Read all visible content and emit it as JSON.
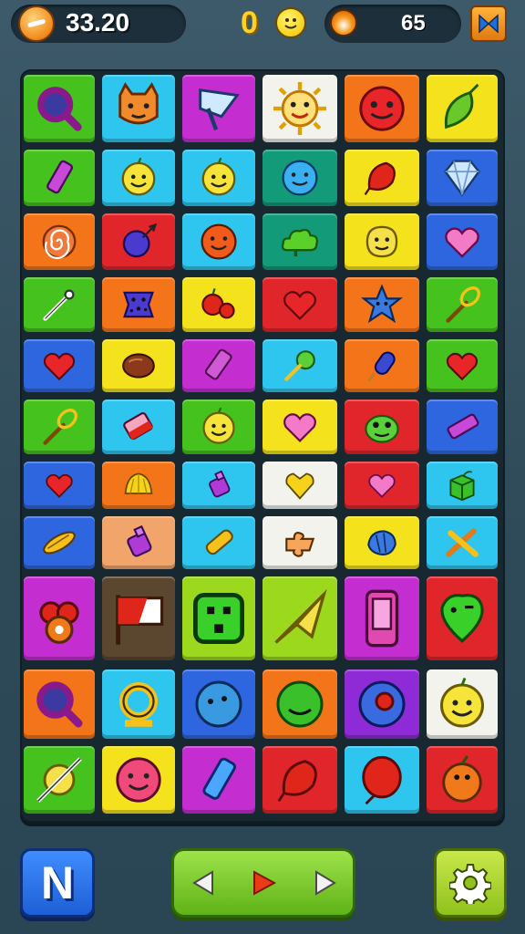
{
  "hud": {
    "score": "33.20",
    "moves": "0",
    "energy": "65"
  },
  "colors": {
    "green": "#46c21e",
    "lime": "#9bd81e",
    "cyan": "#2ec6ef",
    "magenta": "#c42ed0",
    "purple": "#8e2ad6",
    "white": "#f3f3ee",
    "orange": "#f4741a",
    "yellow": "#f4e21c",
    "red": "#e0262a",
    "blue": "#2e66e0",
    "teal": "#139a78",
    "peach": "#f2a56a",
    "brown": "#5b4630"
  },
  "board": {
    "tiles": [
      {
        "row": 0,
        "col": 0,
        "color": "green",
        "icon": "magnifier-icon"
      },
      {
        "row": 0,
        "col": 1,
        "color": "cyan",
        "icon": "cat-face-icon"
      },
      {
        "row": 0,
        "col": 2,
        "color": "magenta",
        "icon": "flag-icon"
      },
      {
        "row": 0,
        "col": 3,
        "color": "white",
        "icon": "sun-face-icon"
      },
      {
        "row": 0,
        "col": 4,
        "color": "orange",
        "icon": "red-smiley-icon"
      },
      {
        "row": 0,
        "col": 5,
        "color": "yellow",
        "icon": "leaf-icon"
      },
      {
        "row": 1,
        "col": 0,
        "color": "green",
        "icon": "crayon-icon"
      },
      {
        "row": 1,
        "col": 1,
        "color": "cyan",
        "icon": "yellow-smiley-icon"
      },
      {
        "row": 1,
        "col": 2,
        "color": "cyan",
        "icon": "yellow-smiley-icon"
      },
      {
        "row": 1,
        "col": 3,
        "color": "teal",
        "icon": "blue-smiley-icon"
      },
      {
        "row": 1,
        "col": 4,
        "color": "yellow",
        "icon": "red-leaf-icon"
      },
      {
        "row": 1,
        "col": 5,
        "color": "blue",
        "icon": "gem-icon"
      },
      {
        "row": 2,
        "col": 0,
        "color": "orange",
        "icon": "swirl-icon"
      },
      {
        "row": 2,
        "col": 1,
        "color": "red",
        "icon": "blue-fruit-icon"
      },
      {
        "row": 2,
        "col": 2,
        "color": "cyan",
        "icon": "orange-smiley-icon"
      },
      {
        "row": 2,
        "col": 3,
        "color": "teal",
        "icon": "cloud-icon"
      },
      {
        "row": 2,
        "col": 4,
        "color": "yellow",
        "icon": "potato-face-icon"
      },
      {
        "row": 2,
        "col": 5,
        "color": "blue",
        "icon": "pink-heart-icon"
      },
      {
        "row": 3,
        "col": 0,
        "color": "green",
        "icon": "wand-icon"
      },
      {
        "row": 3,
        "col": 1,
        "color": "orange",
        "icon": "blue-cookie-icon"
      },
      {
        "row": 3,
        "col": 2,
        "color": "yellow",
        "icon": "apples-icon"
      },
      {
        "row": 3,
        "col": 3,
        "color": "red",
        "icon": "red-heart-icon"
      },
      {
        "row": 3,
        "col": 4,
        "color": "orange",
        "icon": "star-face-icon"
      },
      {
        "row": 3,
        "col": 5,
        "color": "green",
        "icon": "whisk-icon"
      },
      {
        "row": 4,
        "col": 0,
        "color": "blue",
        "icon": "red-heart-icon"
      },
      {
        "row": 4,
        "col": 1,
        "color": "yellow",
        "icon": "bean-icon"
      },
      {
        "row": 4,
        "col": 2,
        "color": "magenta",
        "icon": "purple-eraser-icon"
      },
      {
        "row": 4,
        "col": 3,
        "color": "cyan",
        "icon": "lollipop-icon"
      },
      {
        "row": 4,
        "col": 4,
        "color": "orange",
        "icon": "blue-popsicle-icon"
      },
      {
        "row": 4,
        "col": 5,
        "color": "green",
        "icon": "red-heart-icon"
      },
      {
        "row": 5,
        "col": 0,
        "color": "green",
        "icon": "whisk-icon"
      },
      {
        "row": 5,
        "col": 1,
        "color": "cyan",
        "icon": "eraser-icon"
      },
      {
        "row": 5,
        "col": 2,
        "color": "green",
        "icon": "yellow-smiley-icon"
      },
      {
        "row": 5,
        "col": 3,
        "color": "yellow",
        "icon": "pink-heart-icon"
      },
      {
        "row": 5,
        "col": 4,
        "color": "red",
        "icon": "green-frog-icon"
      },
      {
        "row": 5,
        "col": 5,
        "color": "blue",
        "icon": "purple-crayon-icon"
      },
      {
        "row": 6,
        "col": 0,
        "color": "blue",
        "icon": "red-heart-icon"
      },
      {
        "row": 6,
        "col": 1,
        "color": "orange",
        "icon": "shell-icon"
      },
      {
        "row": 6,
        "col": 2,
        "color": "cyan",
        "icon": "purple-bottle-icon"
      },
      {
        "row": 6,
        "col": 3,
        "color": "white",
        "icon": "gold-heart-icon"
      },
      {
        "row": 6,
        "col": 4,
        "color": "red",
        "icon": "pink-heart-icon"
      },
      {
        "row": 6,
        "col": 5,
        "color": "cyan",
        "icon": "green-cube-icon"
      },
      {
        "row": 7,
        "col": 0,
        "color": "blue",
        "icon": "corn-icon"
      },
      {
        "row": 7,
        "col": 1,
        "color": "peach",
        "icon": "purple-bottle-icon"
      },
      {
        "row": 7,
        "col": 2,
        "color": "cyan",
        "icon": "yellow-crayon-icon"
      },
      {
        "row": 7,
        "col": 3,
        "color": "white",
        "icon": "puzzle-piece-icon"
      },
      {
        "row": 7,
        "col": 4,
        "color": "yellow",
        "icon": "blue-shell-icon"
      },
      {
        "row": 7,
        "col": 5,
        "color": "cyan",
        "icon": "cross-sticks-icon"
      },
      {
        "row": 8,
        "col": 0,
        "color": "magenta",
        "icon": "fruit-bunch-icon"
      },
      {
        "row": 8,
        "col": 1,
        "color": "brown",
        "icon": "red-flag-icon"
      },
      {
        "row": 8,
        "col": 2,
        "color": "lime",
        "icon": "block-face-icon"
      },
      {
        "row": 8,
        "col": 3,
        "color": "lime",
        "icon": "paper-plane-icon"
      },
      {
        "row": 8,
        "col": 4,
        "color": "magenta",
        "icon": "phone-icon"
      },
      {
        "row": 8,
        "col": 5,
        "color": "red",
        "icon": "green-balloon-icon"
      },
      {
        "row": 9,
        "col": 0,
        "color": "orange",
        "icon": "magnifier-icon"
      },
      {
        "row": 9,
        "col": 1,
        "color": "cyan",
        "icon": "ring-icon"
      },
      {
        "row": 9,
        "col": 2,
        "color": "blue",
        "icon": "blue-bubble-icon"
      },
      {
        "row": 9,
        "col": 3,
        "color": "orange",
        "icon": "green-bubble-icon"
      },
      {
        "row": 9,
        "col": 4,
        "color": "purple",
        "icon": "spiral-bubble-icon"
      },
      {
        "row": 9,
        "col": 5,
        "color": "white",
        "icon": "yellow-smiley-icon"
      },
      {
        "row": 10,
        "col": 0,
        "color": "green",
        "icon": "bow-arrow-icon"
      },
      {
        "row": 10,
        "col": 1,
        "color": "yellow",
        "icon": "pink-smiley-icon"
      },
      {
        "row": 10,
        "col": 2,
        "color": "magenta",
        "icon": "blue-crayon-icon"
      },
      {
        "row": 10,
        "col": 3,
        "color": "red",
        "icon": "red-leaf-icon"
      },
      {
        "row": 10,
        "col": 4,
        "color": "cyan",
        "icon": "red-balloon-icon"
      },
      {
        "row": 10,
        "col": 5,
        "color": "red",
        "icon": "orange-fruit-icon"
      }
    ]
  }
}
